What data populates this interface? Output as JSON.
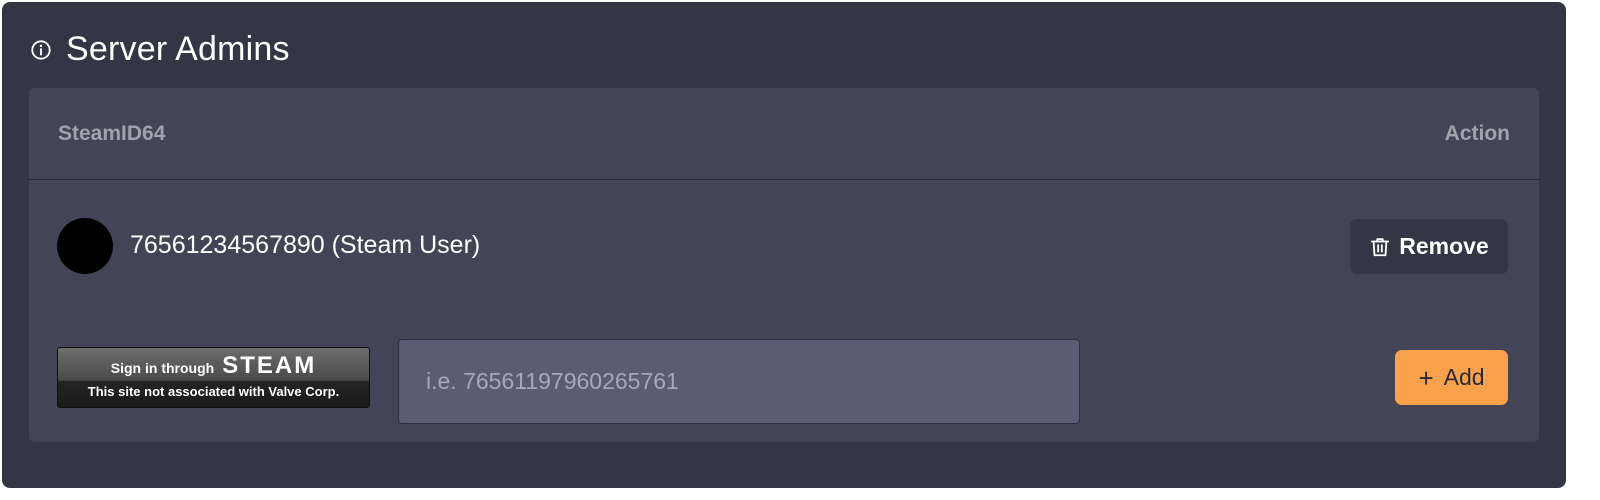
{
  "panel": {
    "title": "Server Admins",
    "info_icon": "info-circle-icon"
  },
  "table": {
    "columns": {
      "steamid": "SteamID64",
      "action": "Action"
    },
    "rows": [
      {
        "avatar_color": "#000000",
        "label": "76561234567890 (Steam User)",
        "remove_label": "Remove",
        "remove_icon": "trash-icon"
      }
    ]
  },
  "add_form": {
    "steam_login": {
      "top_text": "Sign in through",
      "brand_text": "STEAM",
      "disclaimer": "This site not associated with Valve Corp."
    },
    "input_placeholder": "i.e. 76561197960265761",
    "input_value": "",
    "add_label": "Add",
    "add_icon": "plus-icon"
  },
  "colors": {
    "background": "#343646",
    "card": "#434556",
    "accent": "#f9a14b",
    "input": "#5a5c73"
  }
}
